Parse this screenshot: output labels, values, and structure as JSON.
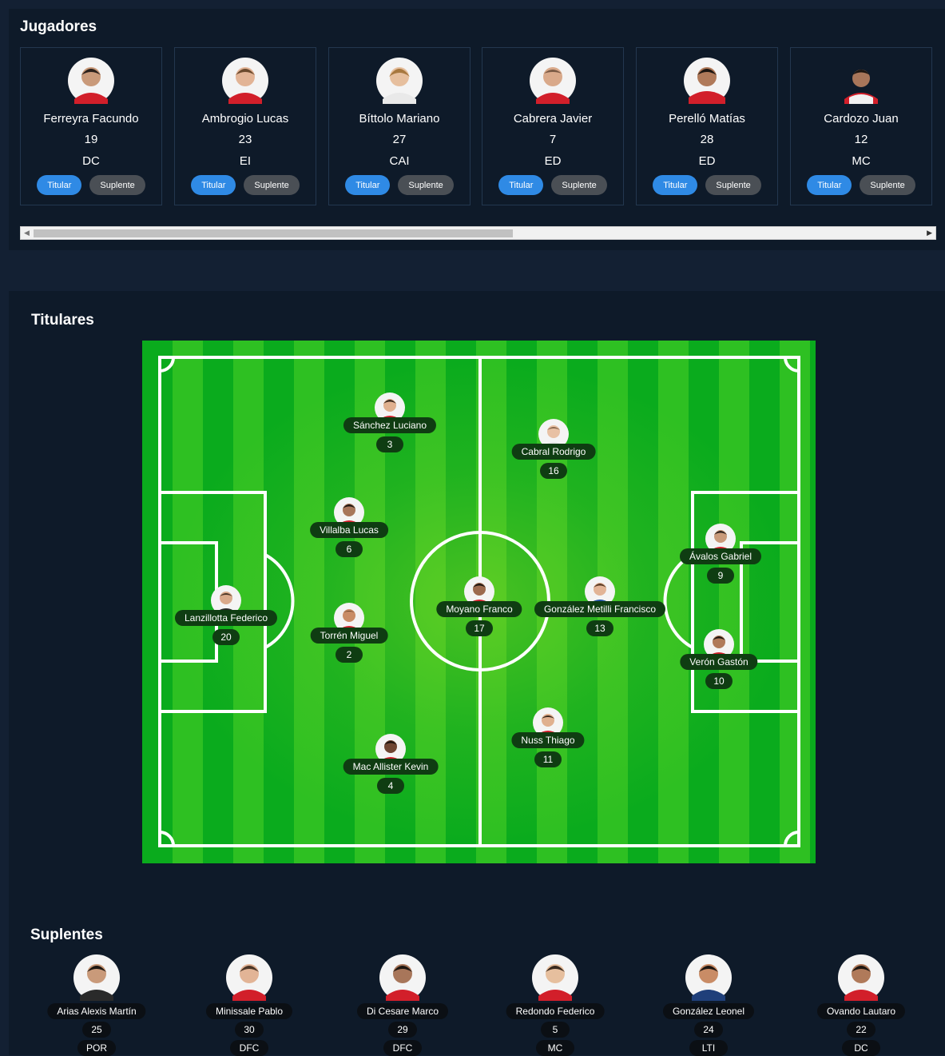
{
  "jugadores": {
    "title": "Jugadores",
    "button_titular": "Titular",
    "button_suplente": "Suplente",
    "cards": [
      {
        "name": "Ferreyra Facundo",
        "number": "19",
        "position": "DC"
      },
      {
        "name": "Ambrogio Lucas",
        "number": "23",
        "position": "EI"
      },
      {
        "name": "Bíttolo Mariano",
        "number": "27",
        "position": "CAI"
      },
      {
        "name": "Cabrera Javier",
        "number": "7",
        "position": "ED"
      },
      {
        "name": "Perelló Matías",
        "number": "28",
        "position": "ED"
      },
      {
        "name": "Cardozo Juan",
        "number": "12",
        "position": "MC"
      }
    ]
  },
  "titulares": {
    "title": "Titulares",
    "players": [
      {
        "name": "Sánchez Luciano",
        "number": "3"
      },
      {
        "name": "Cabral Rodrigo",
        "number": "16"
      },
      {
        "name": "Villalba Lucas",
        "number": "6"
      },
      {
        "name": "Ávalos Gabriel",
        "number": "9"
      },
      {
        "name": "Lanzillotta Federico",
        "number": "20"
      },
      {
        "name": "Moyano Franco",
        "number": "17"
      },
      {
        "name": "González Metilli Francisco",
        "number": "13"
      },
      {
        "name": "Torrén Miguel",
        "number": "2"
      },
      {
        "name": "Verón Gastón",
        "number": "10"
      },
      {
        "name": "Nuss Thiago",
        "number": "11"
      },
      {
        "name": "Mac Allister Kevin",
        "number": "4"
      }
    ]
  },
  "suplentes": {
    "title": "Suplentes",
    "players": [
      {
        "name": "Arias Alexis Martín",
        "number": "25",
        "position": "POR"
      },
      {
        "name": "Minissale Pablo",
        "number": "30",
        "position": "DFC"
      },
      {
        "name": "Di Cesare Marco",
        "number": "29",
        "position": "DFC"
      },
      {
        "name": "Redondo Federico",
        "number": "5",
        "position": "MC"
      },
      {
        "name": "González Leonel",
        "number": "24",
        "position": "LTI"
      },
      {
        "name": "Ovando Lautaro",
        "number": "22",
        "position": "DC"
      }
    ]
  },
  "colors": {
    "background": "#132033",
    "panel": "#0e1a29",
    "titular_button": "#2f8ae5",
    "suplente_button": "#4a4f55",
    "pitch_green": "#0aab1d",
    "pitch_stripe": "#2ec022",
    "label_bg": "#0f3d12"
  },
  "icons": {
    "player_photo": "player-avatar-icon",
    "scroll_left": "arrow-left-icon",
    "scroll_right": "arrow-right-icon"
  }
}
